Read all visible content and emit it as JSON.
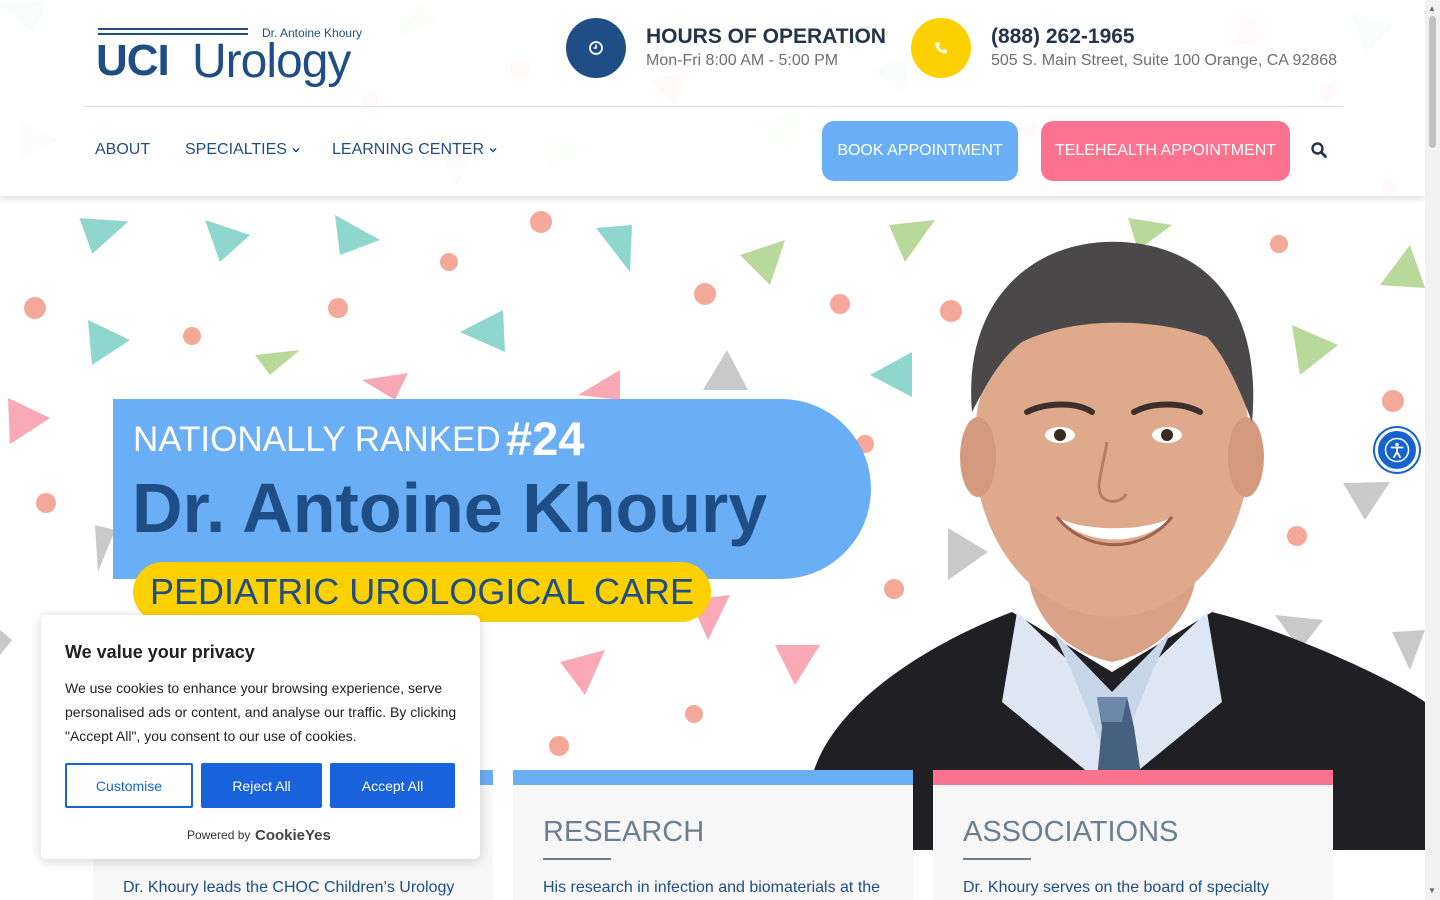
{
  "logo": {
    "doctor": "Dr. Antoine Khoury",
    "uci": "UCI",
    "urology": "Urology"
  },
  "hours": {
    "icon": "clock-icon",
    "title": "HOURS OF OPERATION",
    "text": "Mon-Fri 8:00 AM - 5:00 PM",
    "color": "#1f4e86"
  },
  "contact": {
    "icon": "phone-icon",
    "phone": "(888) 262-1965",
    "address": "505 S. Main Street, Suite 100 Orange, CA 92868",
    "color": "#fdd100"
  },
  "nav": {
    "items": [
      {
        "label": "ABOUT",
        "dropdown": false
      },
      {
        "label": "SPECIALTIES",
        "dropdown": true
      },
      {
        "label": "LEARNING CENTER",
        "dropdown": true
      }
    ],
    "book_label": "BOOK APPOINTMENT",
    "telehealth_label": "TELEHEALTH APPOINTMENT",
    "search_icon": "search-icon"
  },
  "hero": {
    "rank_label": "NATIONALLY RANKED",
    "rank_number": "#24",
    "name": "Dr. Antoine Khoury",
    "tagline": "PEDIATRIC UROLOGICAL CARE"
  },
  "cards": [
    {
      "title": "",
      "text": "Dr. Khoury leads the CHOC Children’s Urology",
      "accent": "#6aaef5"
    },
    {
      "title": "RESEARCH",
      "text": "His research in infection and biomaterials at the",
      "accent": "#6aaef5"
    },
    {
      "title": "ASSOCIATIONS",
      "text": "Dr. Khoury serves on the board of specialty",
      "accent": "#fb738e"
    }
  ],
  "cookie": {
    "title": "We value your privacy",
    "text": "We use cookies to enhance your browsing experience, serve personalised ads or content, and analyse our traffic. By clicking \"Accept All\", you consent to our use of cookies.",
    "customise": "Customise",
    "reject": "Reject All",
    "accept": "Accept All",
    "powered_by": "Powered by",
    "brand": "CookieYes"
  },
  "accessibility": {
    "icon": "accessibility-icon"
  },
  "colors": {
    "brand_blue": "#1f4e86",
    "light_blue": "#6aaef5",
    "pink": "#fb738e",
    "yellow": "#fdd100",
    "cookie_blue": "#1863dc"
  }
}
